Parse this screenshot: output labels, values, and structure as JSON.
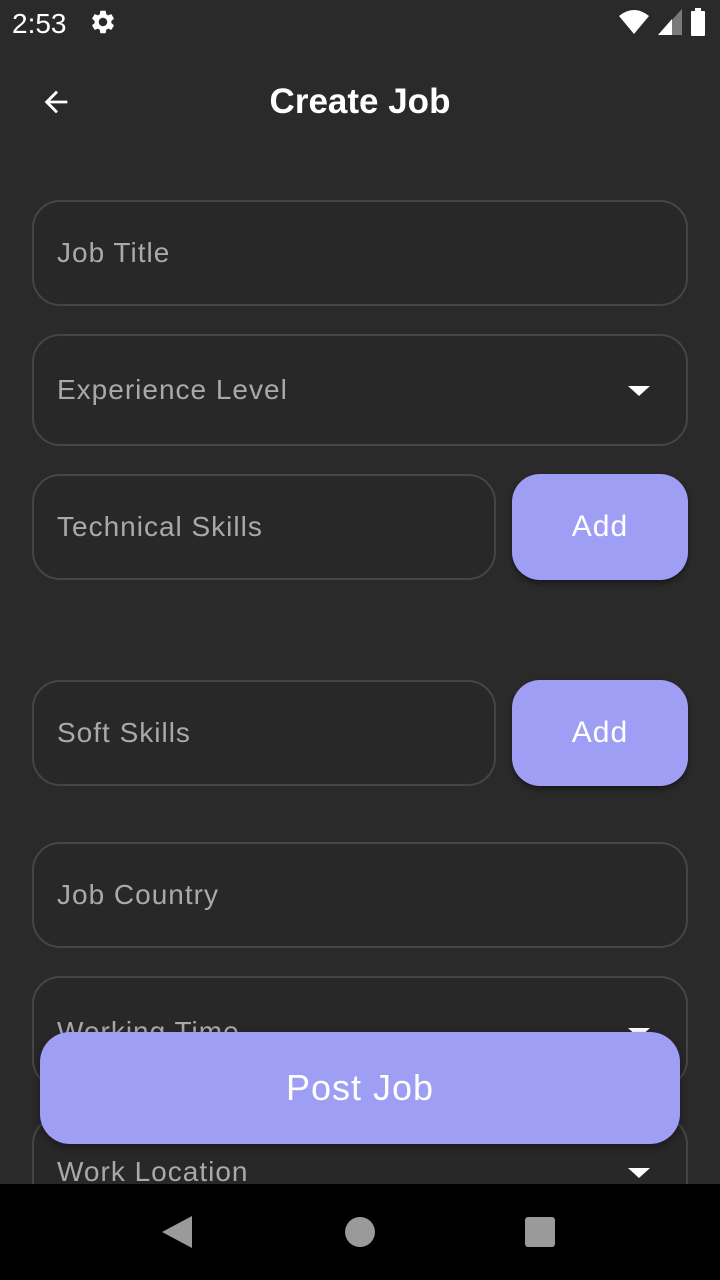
{
  "status_bar": {
    "time": "2:53",
    "icons": [
      "gear-icon",
      "wifi-icon",
      "cellular-signal-icon",
      "battery-icon"
    ]
  },
  "app_bar": {
    "title": "Create Job",
    "back_icon": "arrow-left-icon"
  },
  "form": {
    "job_title": {
      "placeholder": "Job Title"
    },
    "experience_level": {
      "placeholder": "Experience Level",
      "icon": "dropdown-caret-icon"
    },
    "technical_skills": {
      "placeholder": "Technical Skills",
      "add_label": "Add"
    },
    "soft_skills": {
      "placeholder": "Soft Skills",
      "add_label": "Add"
    },
    "job_country": {
      "placeholder": "Job Country"
    },
    "working_time": {
      "placeholder": "Working Time",
      "icon": "dropdown-caret-icon"
    },
    "work_location": {
      "placeholder": "Work Location",
      "icon": "dropdown-caret-icon"
    }
  },
  "post_button": {
    "label": "Post Job"
  },
  "nav_bar": {
    "icons": [
      "nav-back-icon",
      "nav-home-icon",
      "nav-recents-icon"
    ]
  },
  "colors": {
    "background": "#2a2a2a",
    "accent": "#9e9ef5",
    "field_border": "#454545",
    "placeholder_text": "#a9a9a9",
    "nav_bar": "#000000"
  }
}
